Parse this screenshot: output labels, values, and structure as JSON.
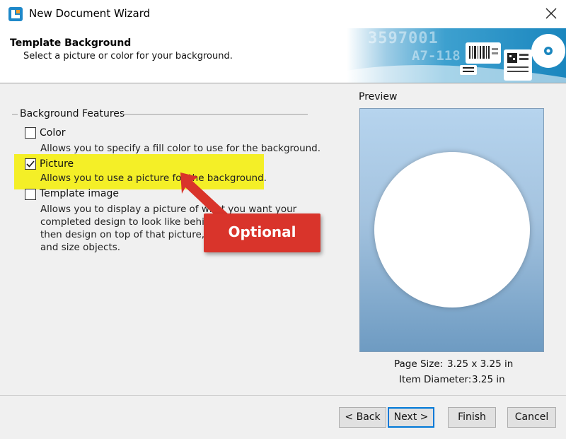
{
  "window": {
    "title": "New Document Wizard",
    "icon": "app-logo-icon",
    "close_icon": "close-icon"
  },
  "header": {
    "title": "Template Background",
    "subtitle": "Select a picture or color for your background.",
    "banner_number": "3597001",
    "banner_code": "A7-118"
  },
  "background_features": {
    "group_label": "Background Features",
    "options": [
      {
        "label": "Color",
        "checked": false,
        "description": "Allows you to specify a fill color to use for the background."
      },
      {
        "label": "Picture",
        "checked": true,
        "description": "Allows you to use a picture for the background."
      },
      {
        "label": "Template image",
        "checked": false,
        "description_lines": [
          "Allows you to display a picture of what you want your",
          "completed design to look like behind",
          "then design on top of that picture, r",
          "and size objects."
        ]
      }
    ]
  },
  "annotation": {
    "label": "Optional",
    "color": "#d9342b",
    "highlight_color": "#f4ef27"
  },
  "preview": {
    "label": "Preview",
    "page_size_label": "Page Size:",
    "page_size_value": "3.25 x 3.25 in",
    "item_diameter_label": "Item Diameter:",
    "item_diameter_value": "3.25 in"
  },
  "buttons": {
    "back": "< Back",
    "next": "Next >",
    "finish": "Finish",
    "cancel": "Cancel"
  },
  "colors": {
    "accent": "#0078d7",
    "preview_top": "#b6d4ee",
    "preview_bottom": "#6e9bc2"
  }
}
